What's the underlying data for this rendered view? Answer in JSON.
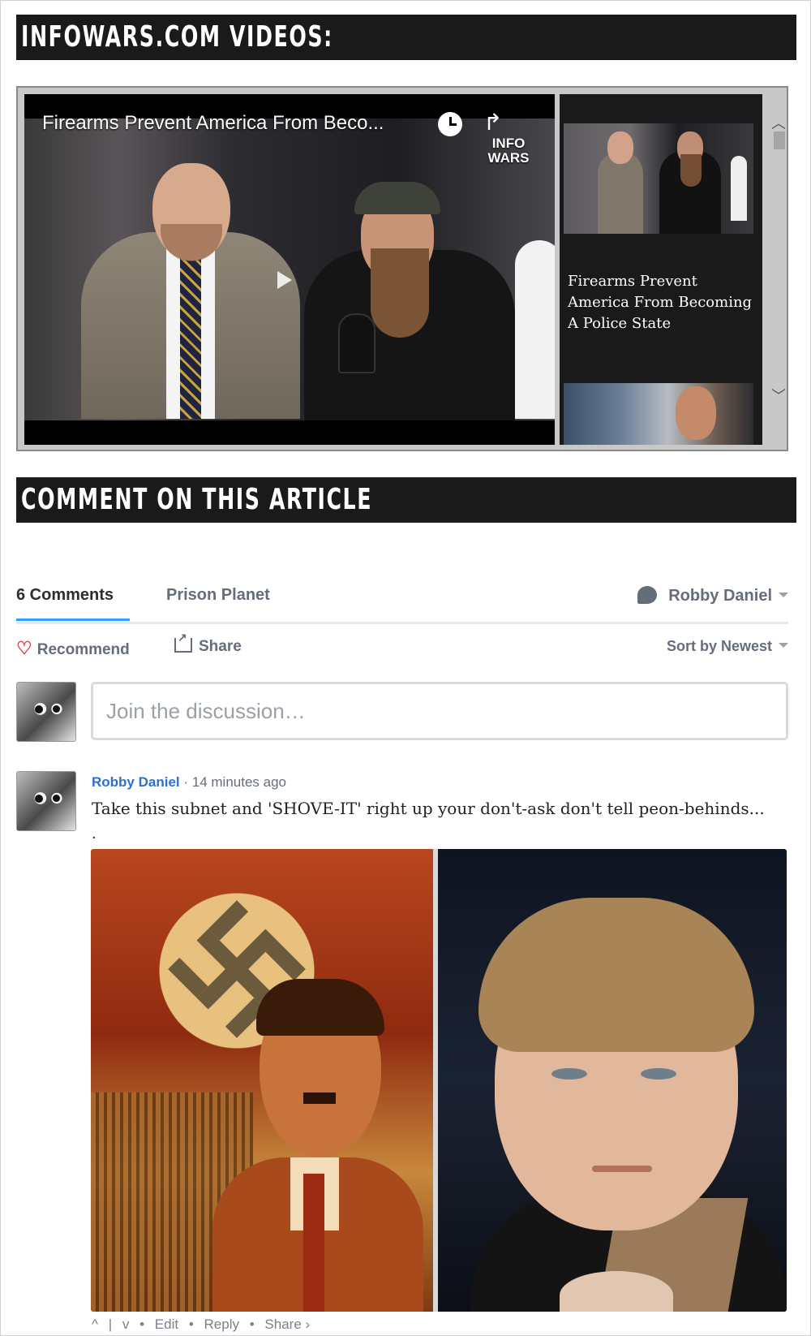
{
  "videos_section": {
    "heading": "INFOWARS.COM VIDEOS:",
    "player": {
      "title": "Firearms Prevent America From Beco...",
      "logo_line1": "INFO",
      "logo_line2": "WARS"
    },
    "playlist": {
      "items": [
        {
          "title": "Firearms Prevent America From Becoming A Police State"
        }
      ]
    }
  },
  "comment_section": {
    "heading": "COMMENT ON THIS ARTICLE"
  },
  "disqus": {
    "tabs": {
      "comments": "6 Comments",
      "community": "Prison Planet"
    },
    "user_menu_name": "Robby Daniel",
    "actions": {
      "recommend": "Recommend",
      "share": "Share",
      "sort": "Sort by Newest"
    },
    "composer": {
      "placeholder": "Join the discussion…"
    },
    "comments": [
      {
        "author": "Robby Daniel",
        "separator": "·",
        "time": "14 minutes ago",
        "text": "Take this subnet and 'SHOVE-IT' right up your don't-ask don't tell peon-behinds...",
        "trailing": ".",
        "footer": {
          "upvote": "^",
          "divider": "|",
          "downvote": "v",
          "edit": "Edit",
          "reply": "Reply",
          "share": "Share ›",
          "sep": "•"
        }
      }
    ]
  },
  "colors": {
    "header_bg": "#1a1a1a",
    "link_blue": "#2e70c9",
    "tab_accent": "#2e9fff",
    "heart_red": "#e0464f"
  }
}
